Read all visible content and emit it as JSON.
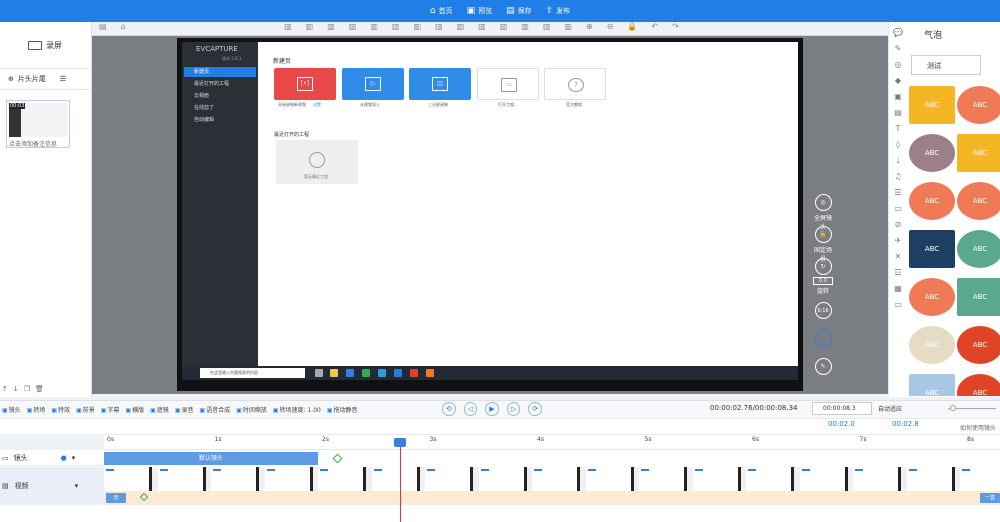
{
  "topbar": {
    "items": [
      {
        "icon": "home-icon",
        "glyph": "⌂",
        "label": "首页"
      },
      {
        "icon": "preview-icon",
        "glyph": "▣",
        "label": "预览"
      },
      {
        "icon": "save-icon",
        "glyph": "▤",
        "label": "保存"
      },
      {
        "icon": "publish-icon",
        "glyph": "⇪",
        "label": "发布"
      }
    ]
  },
  "left": {
    "record_label": "录屏",
    "add_clip_label": "片头片尾",
    "thumb_badge": "00:03",
    "thumb_label": "点击添加备注信息"
  },
  "screen": {
    "logo": "EVCAPTURE",
    "version": "版本 2.8.1",
    "side_items": [
      "新建页",
      "最近打开的工程",
      "云相册",
      "在线剪了",
      "自动编辑"
    ],
    "head": "新建页",
    "cards": [
      {
        "label": "开始录制新视频",
        "color": "#e84848",
        "glyph": "[•]"
      },
      {
        "label": "从视频导入",
        "color": "#2f8ce8",
        "glyph": "▷"
      },
      {
        "label": "三分屏录制",
        "color": "#2f8ce8",
        "glyph": "◫"
      },
      {
        "label": "打开工程...",
        "color": "#ffffff",
        "glyph": "▭"
      },
      {
        "label": "官方教程",
        "color": "#ffffff",
        "glyph": "?"
      }
    ],
    "card_sub": "设置",
    "recent_head": "最近打开的工程",
    "recent_empty": "暂无最近工程",
    "search_placeholder": "在这里输入你要搜索的内容"
  },
  "righttools": [
    {
      "label": "全屏镜头",
      "glyph": "◎"
    },
    {
      "label": "固定场景",
      "glyph": "🔒"
    },
    {
      "label": "旋转",
      "glyph": "↻"
    },
    {
      "label": "",
      "glyph": "9:16"
    },
    {
      "label": "",
      "glyph": "—"
    },
    {
      "label": "",
      "glyph": "✎"
    }
  ],
  "righttools_value": "0.0",
  "asset": {
    "title": "气泡",
    "search": "测试",
    "bubble_text": "ABC",
    "bubbles": [
      {
        "c": "#f5b623"
      },
      {
        "c": "#f07a55"
      },
      {
        "c": "#9b7f8a"
      },
      {
        "c": "#f5b623"
      },
      {
        "c": "#f07a55"
      },
      {
        "c": "#f07a55"
      },
      {
        "c": "#1d3f63"
      },
      {
        "c": "#5aa88f"
      },
      {
        "c": "#f07a55"
      },
      {
        "c": "#5aa88f"
      },
      {
        "c": "#e6dcc6"
      },
      {
        "c": "#e04426"
      },
      {
        "c": "#a8c8e6"
      },
      {
        "c": "#e04426"
      }
    ]
  },
  "ctrlbar": [
    "镜头",
    "转场",
    "特效",
    "前景",
    "字幕",
    "横版",
    "遮镜",
    "录音",
    "语音合成",
    "时间缩放",
    "转场速度: 1.00",
    "拖动静音"
  ],
  "timecode": "00:00:02.76/00:00:08.34",
  "zoom_value": "00:00:08.3",
  "autofit_label": "自动适应",
  "speed1": "00:02.0",
  "speed2": "00:02.8",
  "ticks": [
    "0s",
    "1s",
    "2s",
    "3s",
    "4s",
    "5s",
    "6s",
    "7s",
    "8s"
  ],
  "tracks": {
    "camera": "镜头",
    "video": "视频",
    "camera_clip": "默认镜头",
    "audio_start": "无",
    "audio_end": "一直",
    "tips": "如何使用镜头"
  }
}
